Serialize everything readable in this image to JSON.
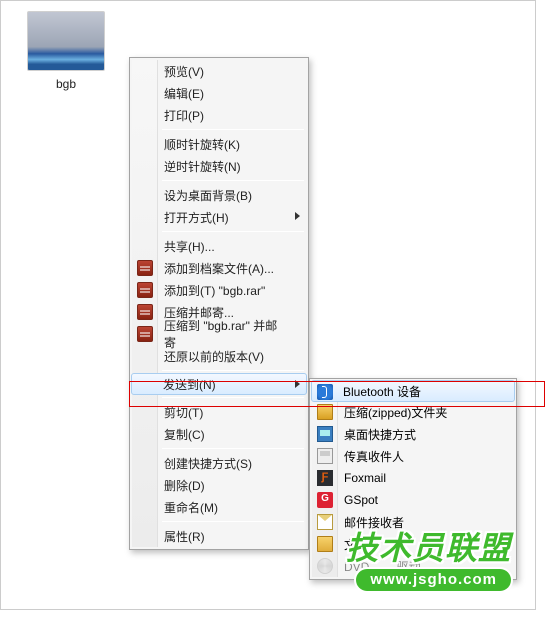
{
  "file": {
    "name": "bgb"
  },
  "menu": {
    "preview": "预览(V)",
    "edit": "编辑(E)",
    "print": "打印(P)",
    "rotate_cw": "顺时针旋转(K)",
    "rotate_ccw": "逆时针旋转(N)",
    "set_wallpaper": "设为桌面背景(B)",
    "open_with": "打开方式(H)",
    "share": "共享(H)...",
    "rar_add_archive": "添加到档案文件(A)...",
    "rar_add_bgb": "添加到(T) \"bgb.rar\"",
    "rar_compress_email": "压缩并邮寄...",
    "rar_compress_bgb_email": "压缩到 \"bgb.rar\" 并邮寄",
    "restore_versions": "还原以前的版本(V)",
    "send_to": "发送到(N)",
    "cut": "剪切(T)",
    "copy": "复制(C)",
    "create_shortcut": "创建快捷方式(S)",
    "delete": "删除(D)",
    "rename": "重命名(M)",
    "properties": "属性(R)"
  },
  "submenu": {
    "bluetooth": "Bluetooth 设备",
    "zipped": "压缩(zipped)文件夹",
    "desktop_shortcut": "桌面快捷方式",
    "fax_recipient": "传真收件人",
    "foxmail": "Foxmail",
    "gspot": "GSpot",
    "mail_recipient": "邮件接收者",
    "documents": "文档",
    "dvd_drive": "DVD ……驱动……"
  },
  "watermark": {
    "brand": "技术员联盟",
    "url": "www.jsgho.com"
  },
  "icon_glyphs": {
    "fox": "Ƒ",
    "gspot": "G"
  }
}
